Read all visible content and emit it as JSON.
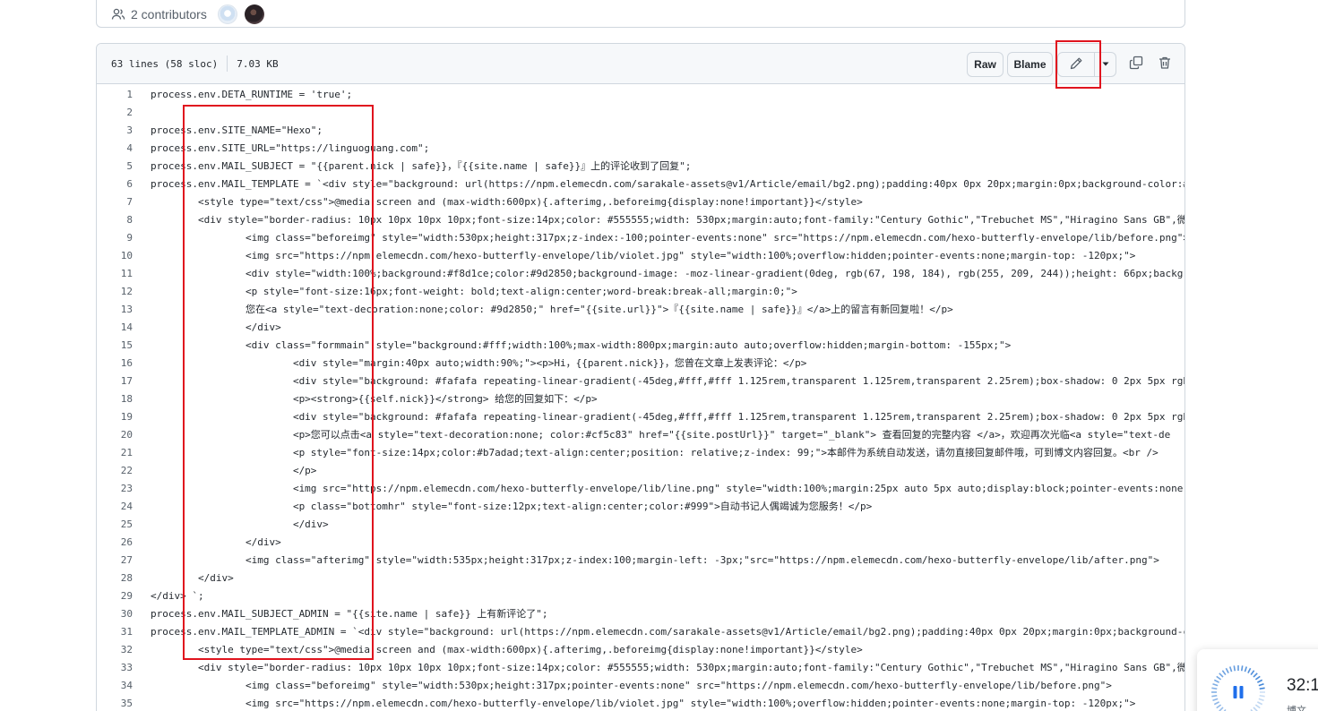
{
  "contributors": {
    "label": "2 contributors"
  },
  "file": {
    "lines_info": "63 lines (58 sloc)",
    "size": "7.03 KB",
    "buttons": {
      "raw": "Raw",
      "blame": "Blame"
    }
  },
  "code_lines": [
    {
      "n": "1",
      "t": "process.env.DETA_RUNTIME = 'true';"
    },
    {
      "n": "2",
      "t": ""
    },
    {
      "n": "3",
      "t": "process.env.SITE_NAME=\"Hexo\";"
    },
    {
      "n": "4",
      "t": "process.env.SITE_URL=\"https://linguoguang.com\";"
    },
    {
      "n": "5",
      "t": "process.env.MAIL_SUBJECT = \"{{parent.nick | safe}}，『{{site.name | safe}}』上的评论收到了回复\";"
    },
    {
      "n": "6",
      "t": "process.env.MAIL_TEMPLATE = `<div style=\"background: url(https://npm.elemecdn.com/sarakale-assets@v1/Article/email/bg2.png);padding:40px 0px 20px;margin:0px;background-color:#"
    },
    {
      "n": "7",
      "t": "        <style type=\"text/css\">@media screen and (max-width:600px){.afterimg,.beforeimg{display:none!important}}</style>"
    },
    {
      "n": "8",
      "t": "        <div style=\"border-radius: 10px 10px 10px 10px;font-size:14px;color: #555555;width: 530px;margin:auto;font-family:\"Century Gothic\",\"Trebuchet MS\",\"Hiragino Sans GB\",微"
    },
    {
      "n": "9",
      "t": "                <img class=\"beforeimg\" style=\"width:530px;height:317px;z-index:-100;pointer-events:none\" src=\"https://npm.elemecdn.com/hexo-butterfly-envelope/lib/before.png\">"
    },
    {
      "n": "10",
      "t": "                <img src=\"https://npm.elemecdn.com/hexo-butterfly-envelope/lib/violet.jpg\" style=\"width:100%;overflow:hidden;pointer-events:none;margin-top: -120px;\">"
    },
    {
      "n": "11",
      "t": "                <div style=\"width:100%;background:#f8d1ce;color:#9d2850;background-image: -moz-linear-gradient(0deg, rgb(67, 198, 184), rgb(255, 209, 244));height: 66px;backgr"
    },
    {
      "n": "12",
      "t": "                <p style=\"font-size:16px;font-weight: bold;text-align:center;word-break:break-all;margin:0;\">"
    },
    {
      "n": "13",
      "t": "                您在<a style=\"text-decoration:none;color: #9d2850;\" href=\"{{site.url}}\">『{{site.name | safe}}』</a>上的留言有新回复啦！</p>"
    },
    {
      "n": "14",
      "t": "                </div>"
    },
    {
      "n": "15",
      "t": "                <div class=\"formmain\" style=\"background:#fff;width:100%;max-width:800px;margin:auto auto;overflow:hidden;margin-bottom: -155px;\">"
    },
    {
      "n": "16",
      "t": "                        <div style=\"margin:40px auto;width:90%;\"><p>Hi，{{parent.nick}}，您曾在文章上发表评论：</p>"
    },
    {
      "n": "17",
      "t": "                        <div style=\"background: #fafafa repeating-linear-gradient(-45deg,#fff,#fff 1.125rem,transparent 1.125rem,transparent 2.25rem);box-shadow: 0 2px 5px rgb"
    },
    {
      "n": "18",
      "t": "                        <p><strong>{{self.nick}}</strong> 给您的回复如下：</p>"
    },
    {
      "n": "19",
      "t": "                        <div style=\"background: #fafafa repeating-linear-gradient(-45deg,#fff,#fff 1.125rem,transparent 1.125rem,transparent 2.25rem);box-shadow: 0 2px 5px rgb"
    },
    {
      "n": "20",
      "t": "                        <p>您可以点击<a style=\"text-decoration:none; color:#cf5c83\" href=\"{{site.postUrl}}\" target=\"_blank\"> 查看回复的完整内容 </a>，欢迎再次光临<a style=\"text-de"
    },
    {
      "n": "21",
      "t": "                        <p style=\"font-size:14px;color:#b7adad;text-align:center;position: relative;z-index: 99;\">本邮件为系统自动发送，请勿直接回复邮件哦，可到博文内容回复。<br />"
    },
    {
      "n": "22",
      "t": "                        </p>"
    },
    {
      "n": "23",
      "t": "                        <img src=\"https://npm.elemecdn.com/hexo-butterfly-envelope/lib/line.png\" style=\"width:100%;margin:25px auto 5px auto;display:block;pointer-events:none\""
    },
    {
      "n": "24",
      "t": "                        <p class=\"bottomhr\" style=\"font-size:12px;text-align:center;color:#999\">自动书记人偶竭诚为您服务！</p>"
    },
    {
      "n": "25",
      "t": "                        </div>"
    },
    {
      "n": "26",
      "t": "                </div>"
    },
    {
      "n": "27",
      "t": "                <img class=\"afterimg\" style=\"width:535px;height:317px;z-index:100;margin-left: -3px;\"src=\"https://npm.elemecdn.com/hexo-butterfly-envelope/lib/after.png\">"
    },
    {
      "n": "28",
      "t": "        </div>"
    },
    {
      "n": "29",
      "t": "</div> `;"
    },
    {
      "n": "30",
      "t": "process.env.MAIL_SUBJECT_ADMIN = \"{{site.name | safe}} 上有新评论了\";"
    },
    {
      "n": "31",
      "t": "process.env.MAIL_TEMPLATE_ADMIN = `<div style=\"background: url(https://npm.elemecdn.com/sarakale-assets@v1/Article/email/bg2.png);padding:40px 0px 20px;margin:0px;background-c"
    },
    {
      "n": "32",
      "t": "        <style type=\"text/css\">@media screen and (max-width:600px){.afterimg,.beforeimg{display:none!important}}</style>"
    },
    {
      "n": "33",
      "t": "        <div style=\"border-radius: 10px 10px 10px 10px;font-size:14px;color: #555555;width: 530px;margin:auto;font-family:\"Century Gothic\",\"Trebuchet MS\",\"Hiragino Sans GB\",微"
    },
    {
      "n": "34",
      "t": "                <img class=\"beforeimg\" style=\"width:530px;height:317px;pointer-events:none\" src=\"https://npm.elemecdn.com/hexo-butterfly-envelope/lib/before.png\">"
    },
    {
      "n": "35",
      "t": "                <img src=\"https://npm.elemecdn.com/hexo-butterfly-envelope/lib/violet.jpg\" style=\"width:100%;overflow:hidden;pointer-events:none;margin-top: -120px;\">"
    }
  ],
  "media_widget": {
    "time": "32:1",
    "sub": "博文"
  },
  "colors": {
    "highlight_box": "#e0141e",
    "border": "#d0d7de",
    "header_bg": "#f6f8fa"
  }
}
